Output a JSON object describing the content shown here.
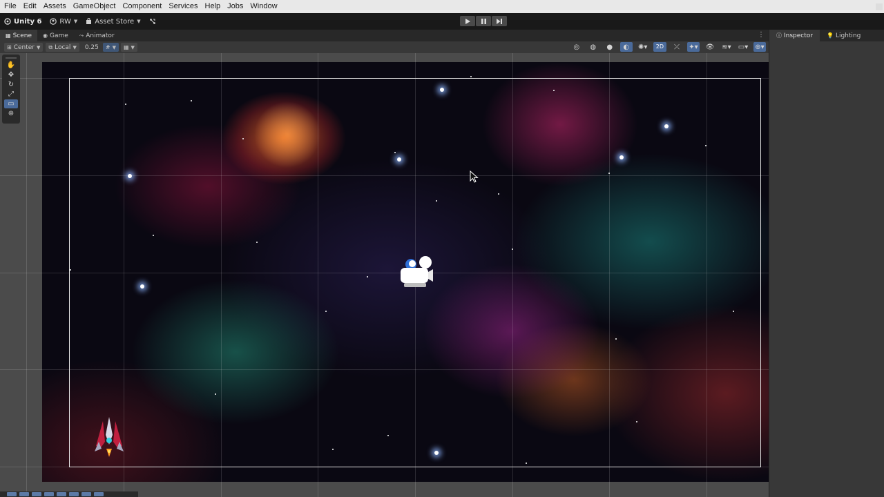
{
  "menu": [
    "File",
    "Edit",
    "Assets",
    "GameObject",
    "Component",
    "Services",
    "Help",
    "Jobs",
    "Window"
  ],
  "toolbar": {
    "product": "Unity 6",
    "account": "RW",
    "asset_store": "Asset Store"
  },
  "tabs": {
    "scene": "Scene",
    "game": "Game",
    "animator": "Animator"
  },
  "scene_toolbar": {
    "pivot": "Center",
    "space": "Local",
    "snap_value": "0.25",
    "mode_2d": "2D"
  },
  "inspector_tabs": {
    "inspector": "Inspector",
    "lighting": "Lighting"
  },
  "icons": {
    "logo": "unity-logo-icon",
    "play": "play-icon",
    "pause": "pause-icon",
    "step": "step-icon",
    "hand": "hand-tool-icon",
    "move": "move-tool-icon",
    "rotate": "rotate-tool-icon",
    "scale": "scale-tool-icon",
    "rect": "rect-tool-icon",
    "transform": "transform-tool-icon"
  },
  "colors": {
    "accent": "#4a6a9a",
    "menubar": "#e8e8e8",
    "toolbar": "#191919",
    "panel": "#383838"
  }
}
